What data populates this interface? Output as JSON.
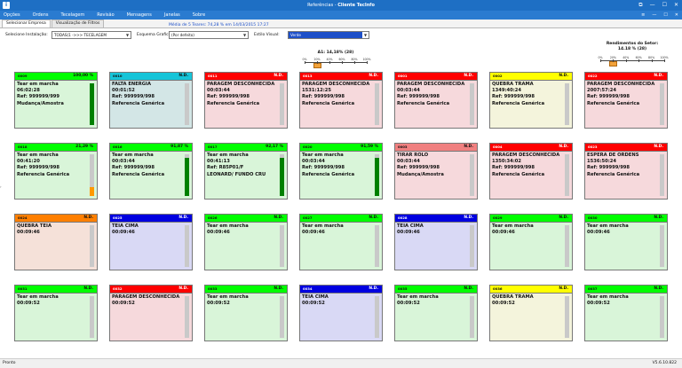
{
  "window": {
    "title_prefix": "Referências",
    "title_suffix": "Cliente TecInfo",
    "app_icon": "app-logo-icon",
    "controls": [
      "⧉",
      "—",
      "☐",
      "✕"
    ]
  },
  "menu": {
    "items": [
      "Opções",
      "Ordens",
      "Tecelagem",
      "Revisão",
      "Mensagens",
      "Janelas",
      "Sobre"
    ],
    "right_controls": [
      "≡",
      "—",
      "☐",
      "✕"
    ]
  },
  "tabs": [
    {
      "label": "Selecionar Empresa",
      "active": true
    },
    {
      "label": "Visualização de Filtros",
      "active": false
    }
  ],
  "media_text": "Média de 5 Teares: 74,28 % em 14/03/2015 17:27",
  "toolbar": {
    "inst_label": "Selecione Instalação:",
    "inst_value": "TODAS(1 ->>> TECELAGEM",
    "grupo_label": "Esquema Grafico:",
    "grupo_value": "(Por defeito)",
    "estilo_label": "Estilo Visual:",
    "estilo_value": "Verde"
  },
  "gauge_a": {
    "title": "A1: 14,18% (28)",
    "labels": [
      "0%",
      "20%",
      "40%",
      "60%",
      "80%",
      "100%"
    ],
    "value": 14.18
  },
  "gauge_setor": {
    "title": "Rendimentos do Setor:",
    "subtitle": "14.18 % (28)",
    "labels": [
      "0%",
      "20%",
      "40%",
      "60%",
      "80%",
      "100%"
    ],
    "value": 14.18
  },
  "colors": {
    "green_head": "#00ff00",
    "green_body": "#d9f5d9",
    "red_head": "#ff0000",
    "red_body": "#f6d9dc",
    "cyan_head": "#16c4d8",
    "cyan_body": "#d3e6e6",
    "yellow_head": "#ffff00",
    "yellow_body": "#f4f4dc",
    "orange_head": "#ff7f00",
    "orange_body": "#f5e1d9",
    "blue_head": "#0000e0",
    "blue_body": "#d9d9f5",
    "salmon_head": "#f08080",
    "salmon_body": "#f6d9dc",
    "bar_green": "#008000",
    "bar_orange": "#ff9900"
  },
  "cards": [
    {
      "code": "0009",
      "pct": "100,00 %",
      "color": "green",
      "bar": 1.0,
      "bar_color": "bar_green",
      "lines": [
        "Tear em marcha",
        "06:02:28",
        "Ref: 999999/999",
        "Mudança/Amostra"
      ]
    },
    {
      "code": "0010",
      "pct": "N.D.",
      "color": "cyan",
      "bar": 0,
      "lines": [
        "FALTA ENERGIA",
        "00:01:52",
        "Ref: 999999/998",
        "Referencia Genérica"
      ]
    },
    {
      "code": "0011",
      "pct": "N.D.",
      "color": "red",
      "bar": 0,
      "lines": [
        "PARAGEM DESCONHECIDA",
        "00:03:44",
        "Ref: 999999/998",
        "Referencia Genérica"
      ]
    },
    {
      "code": "0013",
      "pct": "N.D.",
      "color": "red",
      "bar": 0,
      "lines": [
        "PARAGEM DESCONHECIDA",
        "1531:12:25",
        "Ref: 999999/998",
        "Referencia Genérica"
      ]
    },
    {
      "code": "0001",
      "pct": "N.D.",
      "color": "red",
      "bar": 0,
      "lines": [
        "PARAGEM DESCONHECIDA",
        "00:03:44",
        "Ref: 999999/998",
        "Referencia Genérica"
      ]
    },
    {
      "code": "0002",
      "pct": "N.D.",
      "color": "yellow",
      "bar": 0,
      "lines": [
        "QUEBRA TRAMA",
        "1349:40:24",
        "Ref: 999999/998",
        "Referencia Genérica"
      ]
    },
    {
      "code": "0022",
      "pct": "N.D.",
      "color": "red",
      "bar": 0,
      "lines": [
        "PARAGEM DESCONHECIDA",
        "2007:57:24",
        "Ref: 999999/998",
        "Referencia Genérica"
      ]
    },
    {
      "code": "0018",
      "pct": "21,29 %",
      "color": "green",
      "bar": 0.21,
      "bar_color": "bar_orange",
      "lines": [
        "Tear em marcha",
        "00:41:20",
        "Ref: 999999/998",
        "Referencia Genérica"
      ]
    },
    {
      "code": "0016",
      "pct": "91,87 %",
      "color": "green",
      "bar": 0.92,
      "bar_color": "bar_green",
      "lines": [
        "Tear em marcha",
        "00:03:44",
        "Ref: 999999/998",
        "Referencia Genérica"
      ]
    },
    {
      "code": "0017",
      "pct": "92,17 %",
      "color": "green",
      "bar": 0.92,
      "bar_color": "bar_green",
      "lines": [
        "Tear em marcha",
        "00:41:13",
        "Ref: R85P01/F",
        "LEONARD/ FUNDO CRU"
      ]
    },
    {
      "code": "0020",
      "pct": "91,59 %",
      "color": "green",
      "bar": 0.92,
      "bar_color": "bar_green",
      "lines": [
        "Tear em marcha",
        "00:03:44",
        "Ref: 999999/998",
        "Referencia Genérica"
      ]
    },
    {
      "code": "0003",
      "pct": "N.D.",
      "color": "salmon",
      "bar": 0,
      "lines": [
        "TIRAR ROLO",
        "00:03:44",
        "Ref: 999999/998",
        "Mudança/Amostra"
      ]
    },
    {
      "code": "0004",
      "pct": "N.D.",
      "color": "red",
      "bar": 0,
      "lines": [
        "PARAGEM DESCONHECIDA",
        "1350:34:02",
        "Ref: 999999/998",
        "Referencia Genérica"
      ]
    },
    {
      "code": "0023",
      "pct": "N.D.",
      "color": "red",
      "bar": 0,
      "lines": [
        "ESPERA DE ORDENS",
        "1536:50:24",
        "Ref: 999999/998",
        "Referencia Genérica"
      ]
    },
    {
      "code": "0024",
      "pct": "N.D.",
      "color": "orange",
      "bar": 0,
      "lines": [
        "QUEBRA TEIA",
        "00:09:46"
      ]
    },
    {
      "code": "0025",
      "pct": "N.D.",
      "color": "blue",
      "bar": 0,
      "lines": [
        "TEIA CIMA",
        "00:09:46"
      ]
    },
    {
      "code": "0026",
      "pct": "N.D.",
      "color": "green",
      "bar": 0,
      "lines": [
        "Tear em marcha",
        "00:09:46"
      ]
    },
    {
      "code": "0027",
      "pct": "N.D.",
      "color": "green",
      "bar": 0,
      "lines": [
        "Tear em marcha",
        "00:09:46"
      ]
    },
    {
      "code": "0028",
      "pct": "N.D.",
      "color": "blue",
      "bar": 0,
      "lines": [
        "TEIA CIMA",
        "00:09:46"
      ]
    },
    {
      "code": "0029",
      "pct": "N.D.",
      "color": "green",
      "bar": 0,
      "lines": [
        "Tear em marcha",
        "00:09:46"
      ]
    },
    {
      "code": "0030",
      "pct": "N.D.",
      "color": "green",
      "bar": 0,
      "lines": [
        "Tear em marcha",
        "00:09:46"
      ]
    },
    {
      "code": "0031",
      "pct": "N.D.",
      "color": "green",
      "bar": 0,
      "lines": [
        "Tear em marcha",
        "00:09:52"
      ]
    },
    {
      "code": "0032",
      "pct": "N.D.",
      "color": "red",
      "bar": 0,
      "lines": [
        "PARAGEM DESCONHECIDA",
        "00:09:52"
      ]
    },
    {
      "code": "0033",
      "pct": "N.D.",
      "color": "green",
      "bar": 0,
      "lines": [
        "Tear em marcha",
        "00:09:52"
      ]
    },
    {
      "code": "0034",
      "pct": "N.D.",
      "color": "blue",
      "bar": 0,
      "lines": [
        "TEIA CIMA",
        "00:09:52"
      ]
    },
    {
      "code": "0035",
      "pct": "N.D.",
      "color": "green",
      "bar": 0,
      "lines": [
        "Tear em marcha",
        "00:09:52"
      ]
    },
    {
      "code": "0036",
      "pct": "N.D.",
      "color": "yellow",
      "bar": 0,
      "lines": [
        "QUEBRA TRAMA",
        "00:09:52"
      ]
    },
    {
      "code": "0037",
      "pct": "N.D.",
      "color": "green",
      "bar": 0,
      "lines": [
        "Tear em marcha",
        "00:09:52"
      ]
    }
  ],
  "status": {
    "left": "Pronto",
    "right": "V5.6.10.822"
  }
}
